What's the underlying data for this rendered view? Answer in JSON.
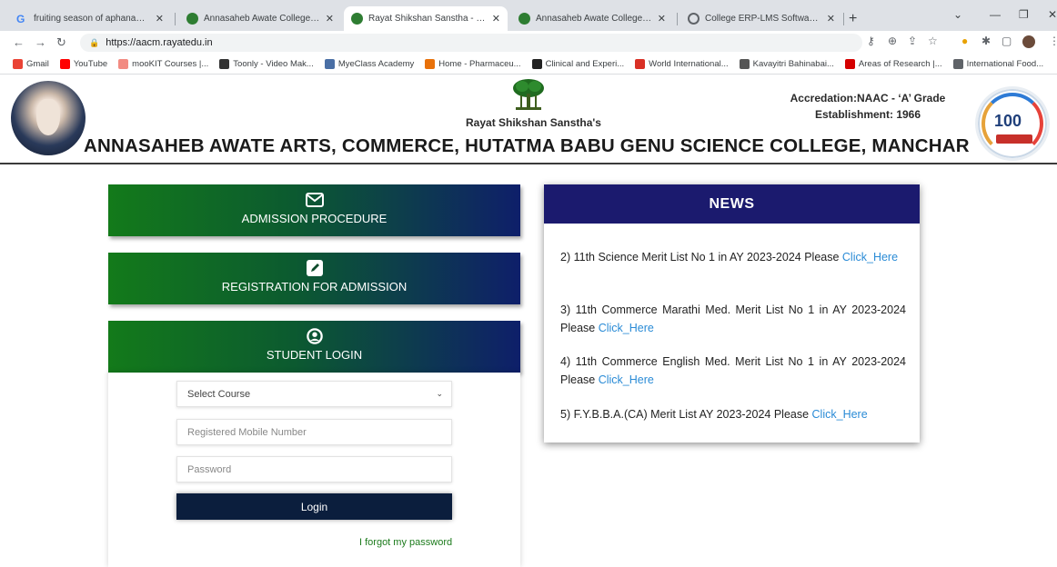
{
  "browser": {
    "tabs": [
      {
        "title": "fruiting season of aphanamixis p",
        "active": false
      },
      {
        "title": "Annasaheb Awate College | Man",
        "active": false
      },
      {
        "title": "Rayat Shikshan Sanstha - Satara",
        "active": true
      },
      {
        "title": "Annasaheb Awate College | Man",
        "active": false
      },
      {
        "title": "College ERP-LMS Software :: KBP",
        "active": false
      }
    ],
    "url": "https://aacm.rayatedu.in",
    "bookmarks": [
      {
        "label": "Gmail",
        "icon": "gmail-icon",
        "color": "#ea4335"
      },
      {
        "label": "YouTube",
        "icon": "youtube-icon",
        "color": "#ff0000"
      },
      {
        "label": "mooKIT Courses |...",
        "icon": "mookit-icon",
        "color": "#f28b82"
      },
      {
        "label": "Toonly - Video Mak...",
        "icon": "toonly-icon",
        "color": "#333333"
      },
      {
        "label": "MyeClass Academy",
        "icon": "myeclass-icon",
        "color": "#4a6fa5"
      },
      {
        "label": "Home - Pharmaceu...",
        "icon": "pharma-icon",
        "color": "#e8710a"
      },
      {
        "label": "Clinical and Experi...",
        "icon": "clinical-icon",
        "color": "#222222"
      },
      {
        "label": "World International...",
        "icon": "world-icon",
        "color": "#d93025"
      },
      {
        "label": "Kavayitri Bahinabai...",
        "icon": "kavayitri-icon",
        "color": "#555555"
      },
      {
        "label": "Areas of Research |...",
        "icon": "research-icon",
        "color": "#d50000"
      },
      {
        "label": "International Food...",
        "icon": "globe-icon",
        "color": "#5f6368"
      }
    ]
  },
  "header": {
    "sanstha": "Rayat Shikshan Sanstha's",
    "accreditation": "Accredation:NAAC - ‘A’ Grade",
    "establishment": "Establishment: 1966",
    "college_name": "ANNASAHEB AWATE ARTS, COMMERCE, HUTATMA BABU GENU SCIENCE COLLEGE, MANCHAR",
    "badge_text": "100"
  },
  "menu": {
    "admission": "ADMISSION PROCEDURE",
    "registration": "REGISTRATION FOR ADMISSION",
    "student_login": "STUDENT LOGIN"
  },
  "login": {
    "course_select": "Select Course",
    "mobile_placeholder": "Registered Mobile Number",
    "password_placeholder": "Password",
    "login_label": "Login",
    "forgot_label": "I forgot my password"
  },
  "news": {
    "heading": "NEWS",
    "items": [
      {
        "text": "2) 11th Science Merit List No 1 in AY 2023-2024 Please ",
        "link": "Click_Here"
      },
      {
        "text": "3) 11th Commerce Marathi Med. Merit List No 1 in AY 2023-2024 Please ",
        "link": "Click_Here"
      },
      {
        "text": "4) 11th Commerce English Med. Merit List No 1 in AY 2023-2024 Please ",
        "link": "Click_Here"
      },
      {
        "text": "5) F.Y.B.B.A.(CA) Merit List AY 2023-2024 Please ",
        "link": "Click_Here"
      }
    ]
  },
  "colors": {
    "button_green": "#137a1a",
    "button_navy": "#0e1f6a",
    "news_header": "#1b1a6e",
    "link_blue": "#2a8bd6",
    "forgot_green": "#1c7b1c"
  }
}
